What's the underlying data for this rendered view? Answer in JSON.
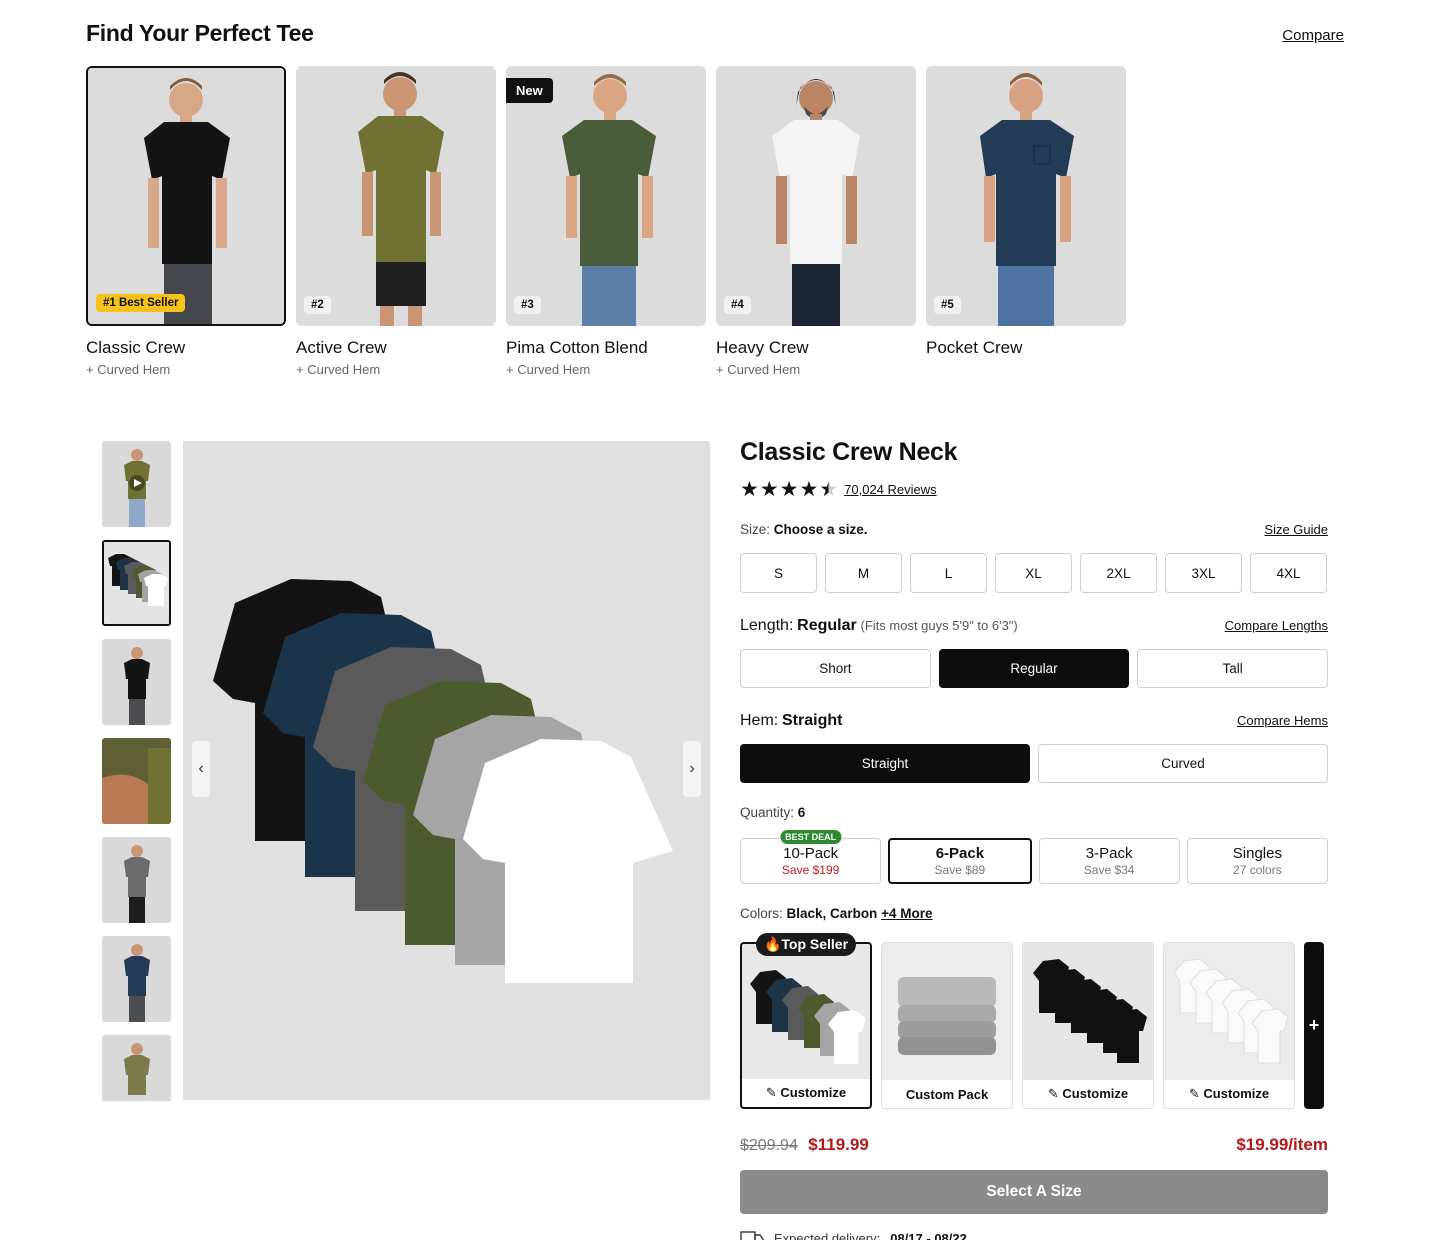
{
  "header": {
    "title": "Find Your Perfect Tee",
    "compare_label": "Compare"
  },
  "tees": [
    {
      "name": "Classic Crew",
      "sub": "+ Curved Hem",
      "badge": "#1 Best Seller",
      "shirt_color": "#141414"
    },
    {
      "name": "Active Crew",
      "sub": "+ Curved Hem",
      "badge": "#2",
      "shirt_color": "#6f7233"
    },
    {
      "name": "Pima Cotton Blend",
      "sub": "+ Curved Hem",
      "badge": "#3",
      "new_label": "New",
      "shirt_color": "#4a5c3a"
    },
    {
      "name": "Heavy Crew",
      "sub": "+ Curved Hem",
      "badge": "#4",
      "shirt_color": "#f4f4f4"
    },
    {
      "name": "Pocket Crew",
      "sub": "",
      "badge": "#5",
      "shirt_color": "#233b57"
    }
  ],
  "gallery": {
    "prev_icon": "‹",
    "next_icon": "›"
  },
  "product": {
    "title": "Classic Crew Neck",
    "rating": 4.5,
    "reviews_label": "70,024 Reviews",
    "size": {
      "label": "Size:",
      "value": "Choose a size.",
      "guide_label": "Size Guide",
      "options": [
        "S",
        "M",
        "L",
        "XL",
        "2XL",
        "3XL",
        "4XL"
      ]
    },
    "length": {
      "label": "Length:",
      "value": "Regular",
      "note": "(Fits most guys 5'9\" to 6'3\")",
      "compare_label": "Compare Lengths",
      "options": [
        "Short",
        "Regular",
        "Tall"
      ],
      "selected": "Regular"
    },
    "hem": {
      "label": "Hem:",
      "value": "Straight",
      "compare_label": "Compare Hems",
      "options": [
        "Straight",
        "Curved"
      ],
      "selected": "Straight"
    },
    "quantity": {
      "label": "Quantity:",
      "value": "6",
      "packs": [
        {
          "name": "10-Pack",
          "save": "Save $199",
          "badge": "BEST DEAL"
        },
        {
          "name": "6-Pack",
          "save": "Save $89"
        },
        {
          "name": "3-Pack",
          "save": "Save $34"
        },
        {
          "name": "Singles",
          "save": "27 colors"
        }
      ]
    },
    "colors": {
      "label": "Colors:",
      "value": "Black, Carbon",
      "more_label": "+4 More",
      "swatches": [
        {
          "label": "✎ Customize",
          "badge": "🔥Top Seller"
        },
        {
          "label": "Custom Pack"
        },
        {
          "label": "✎ Customize"
        },
        {
          "label": "✎ Customize"
        }
      ],
      "plus_label": "+"
    },
    "price": {
      "original": "$209.94",
      "sale": "$119.99",
      "per_item": "$19.99/item"
    },
    "cta_label": "Select A Size",
    "delivery": {
      "label": "Expected delivery:",
      "dates": "08/17 - 08/22"
    }
  },
  "colors": {
    "accent_red": "#b11a1a",
    "best_seller_gold": "#f6c21c",
    "best_deal_green": "#2d8a2f"
  }
}
